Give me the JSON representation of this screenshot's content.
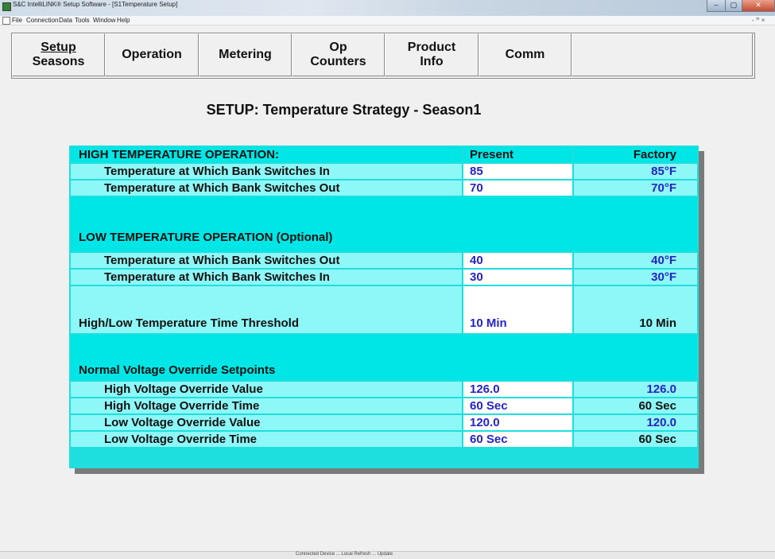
{
  "window": {
    "title": "S&C IntelliLINK® Setup Software - [S1Temperature Setup]",
    "controls": {
      "minimize": "–",
      "maximize": "▢",
      "close": "✕"
    }
  },
  "menubar": {
    "items": [
      "File",
      "Connection",
      "Data",
      "Tools",
      "Window",
      "Help"
    ],
    "mdi_controls": "- ꟸ ×"
  },
  "tabs": [
    {
      "line1": "Setup",
      "line2": "Seasons"
    },
    {
      "line1": "Operation",
      "line2": ""
    },
    {
      "line1": "Metering",
      "line2": ""
    },
    {
      "line1": "Op",
      "line2": "Counters"
    },
    {
      "line1": "Product",
      "line2": "Info"
    },
    {
      "line1": "Comm",
      "line2": ""
    },
    {
      "line1": "",
      "line2": ""
    }
  ],
  "page": {
    "heading": "SETUP: Temperature Strategy - Season1"
  },
  "table": {
    "section_high": "HIGH TEMPERATURE OPERATION:",
    "col_present": "Present",
    "col_factory": "Factory",
    "rows": [
      {
        "label": "Temperature at Which Bank Switches In",
        "present": "85",
        "factory": "85°F"
      },
      {
        "label": "Temperature at Which Bank Switches Out",
        "present": "70",
        "factory": "70°F"
      },
      {
        "label": "Temperature at Which Bank Switches Out",
        "present": "40",
        "factory": "40°F"
      },
      {
        "label": "Temperature at Which Bank Switches In",
        "present": "30",
        "factory": "30°F"
      },
      {
        "label": "High/Low Temperature Time Threshold",
        "present": "10 Min",
        "factory": "10 Min"
      },
      {
        "label": "High Voltage Override Value",
        "present": "126.0",
        "factory": "126.0"
      },
      {
        "label": "High Voltage Override Time",
        "present": "60 Sec",
        "factory": "60 Sec"
      },
      {
        "label": "Low Voltage Override Value",
        "present": "120.0",
        "factory": "120.0"
      },
      {
        "label": "Low Voltage Override Time",
        "present": "60 Sec",
        "factory": "60 Sec"
      }
    ],
    "section_low": "LOW TEMPERATURE OPERATION (Optional)",
    "section_voltage": "Normal Voltage Override Setpoints"
  },
  "statusbar": {
    "text": "Connected   Device   ...   Local   Refresh   ...   Update"
  },
  "colors": {
    "cyan_dark": "#00e6e6",
    "cyan_light": "#8ef7f7",
    "value_blue": "#2424c4"
  }
}
